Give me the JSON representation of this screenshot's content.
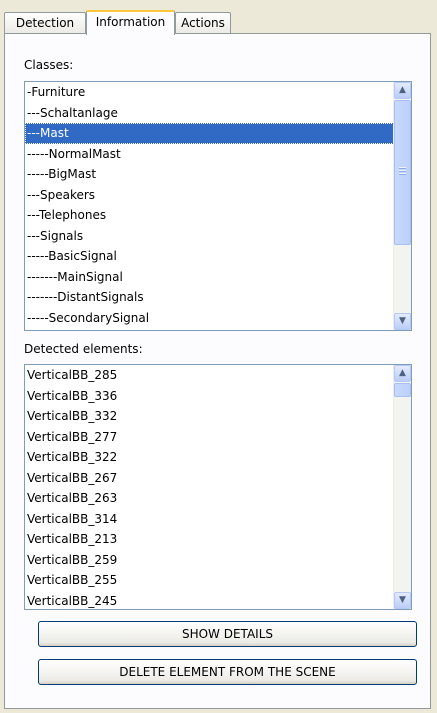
{
  "tabs": [
    "Detection",
    "Information",
    "Actions"
  ],
  "classes": {
    "label": "Classes:",
    "items": [
      "-Furniture",
      "---Schaltanlage",
      "---Mast",
      "-----NormalMast",
      "-----BigMast",
      "---Speakers",
      "---Telephones",
      "---Signals",
      "-----BasicSignal",
      "-------MainSignal",
      "-------DistantSignals",
      "-----SecondarySignal"
    ],
    "selected": "---Mast"
  },
  "detected": {
    "label": "Detected elements:",
    "items": [
      "VerticalBB_285",
      "VerticalBB_336",
      "VerticalBB_332",
      "VerticalBB_277",
      "VerticalBB_322",
      "VerticalBB_267",
      "VerticalBB_263",
      "VerticalBB_314",
      "VerticalBB_213",
      "VerticalBB_259",
      "VerticalBB_255",
      "VerticalBB_245"
    ]
  },
  "buttons": {
    "show_details": "SHOW DETAILS",
    "delete_element": "DELETE ELEMENT FROM THE SCENE"
  },
  "icons": {
    "scroll_up": "scroll-up-arrow-icon",
    "scroll_down": "scroll-down-arrow-icon"
  },
  "colors": {
    "selection": "#316ac5",
    "active_tab_accent": "#ffc83c",
    "window_bg": "#ece9d8"
  }
}
